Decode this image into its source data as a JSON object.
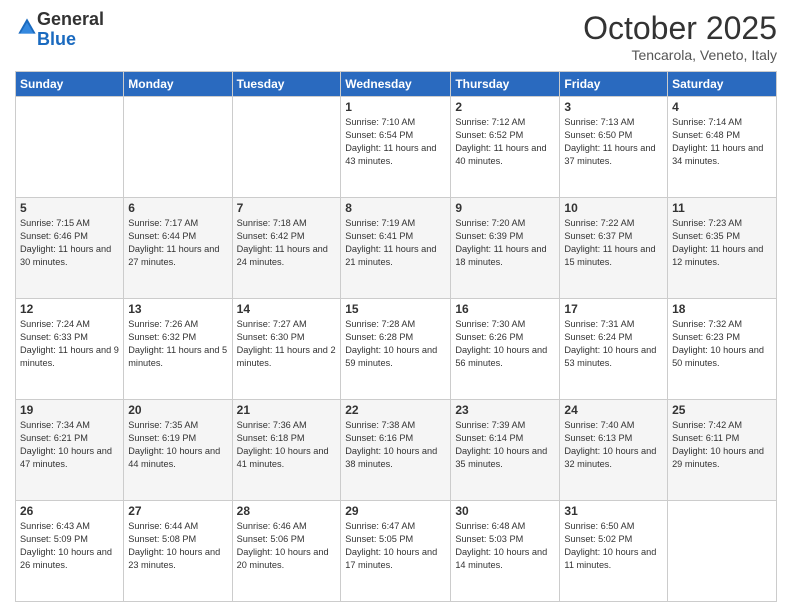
{
  "logo": {
    "general": "General",
    "blue": "Blue"
  },
  "header": {
    "month": "October 2025",
    "location": "Tencarola, Veneto, Italy"
  },
  "days_of_week": [
    "Sunday",
    "Monday",
    "Tuesday",
    "Wednesday",
    "Thursday",
    "Friday",
    "Saturday"
  ],
  "weeks": [
    [
      {
        "day": "",
        "sunrise": "",
        "sunset": "",
        "daylight": ""
      },
      {
        "day": "",
        "sunrise": "",
        "sunset": "",
        "daylight": ""
      },
      {
        "day": "",
        "sunrise": "",
        "sunset": "",
        "daylight": ""
      },
      {
        "day": "1",
        "sunrise": "Sunrise: 7:10 AM",
        "sunset": "Sunset: 6:54 PM",
        "daylight": "Daylight: 11 hours and 43 minutes."
      },
      {
        "day": "2",
        "sunrise": "Sunrise: 7:12 AM",
        "sunset": "Sunset: 6:52 PM",
        "daylight": "Daylight: 11 hours and 40 minutes."
      },
      {
        "day": "3",
        "sunrise": "Sunrise: 7:13 AM",
        "sunset": "Sunset: 6:50 PM",
        "daylight": "Daylight: 11 hours and 37 minutes."
      },
      {
        "day": "4",
        "sunrise": "Sunrise: 7:14 AM",
        "sunset": "Sunset: 6:48 PM",
        "daylight": "Daylight: 11 hours and 34 minutes."
      }
    ],
    [
      {
        "day": "5",
        "sunrise": "Sunrise: 7:15 AM",
        "sunset": "Sunset: 6:46 PM",
        "daylight": "Daylight: 11 hours and 30 minutes."
      },
      {
        "day": "6",
        "sunrise": "Sunrise: 7:17 AM",
        "sunset": "Sunset: 6:44 PM",
        "daylight": "Daylight: 11 hours and 27 minutes."
      },
      {
        "day": "7",
        "sunrise": "Sunrise: 7:18 AM",
        "sunset": "Sunset: 6:42 PM",
        "daylight": "Daylight: 11 hours and 24 minutes."
      },
      {
        "day": "8",
        "sunrise": "Sunrise: 7:19 AM",
        "sunset": "Sunset: 6:41 PM",
        "daylight": "Daylight: 11 hours and 21 minutes."
      },
      {
        "day": "9",
        "sunrise": "Sunrise: 7:20 AM",
        "sunset": "Sunset: 6:39 PM",
        "daylight": "Daylight: 11 hours and 18 minutes."
      },
      {
        "day": "10",
        "sunrise": "Sunrise: 7:22 AM",
        "sunset": "Sunset: 6:37 PM",
        "daylight": "Daylight: 11 hours and 15 minutes."
      },
      {
        "day": "11",
        "sunrise": "Sunrise: 7:23 AM",
        "sunset": "Sunset: 6:35 PM",
        "daylight": "Daylight: 11 hours and 12 minutes."
      }
    ],
    [
      {
        "day": "12",
        "sunrise": "Sunrise: 7:24 AM",
        "sunset": "Sunset: 6:33 PM",
        "daylight": "Daylight: 11 hours and 9 minutes."
      },
      {
        "day": "13",
        "sunrise": "Sunrise: 7:26 AM",
        "sunset": "Sunset: 6:32 PM",
        "daylight": "Daylight: 11 hours and 5 minutes."
      },
      {
        "day": "14",
        "sunrise": "Sunrise: 7:27 AM",
        "sunset": "Sunset: 6:30 PM",
        "daylight": "Daylight: 11 hours and 2 minutes."
      },
      {
        "day": "15",
        "sunrise": "Sunrise: 7:28 AM",
        "sunset": "Sunset: 6:28 PM",
        "daylight": "Daylight: 10 hours and 59 minutes."
      },
      {
        "day": "16",
        "sunrise": "Sunrise: 7:30 AM",
        "sunset": "Sunset: 6:26 PM",
        "daylight": "Daylight: 10 hours and 56 minutes."
      },
      {
        "day": "17",
        "sunrise": "Sunrise: 7:31 AM",
        "sunset": "Sunset: 6:24 PM",
        "daylight": "Daylight: 10 hours and 53 minutes."
      },
      {
        "day": "18",
        "sunrise": "Sunrise: 7:32 AM",
        "sunset": "Sunset: 6:23 PM",
        "daylight": "Daylight: 10 hours and 50 minutes."
      }
    ],
    [
      {
        "day": "19",
        "sunrise": "Sunrise: 7:34 AM",
        "sunset": "Sunset: 6:21 PM",
        "daylight": "Daylight: 10 hours and 47 minutes."
      },
      {
        "day": "20",
        "sunrise": "Sunrise: 7:35 AM",
        "sunset": "Sunset: 6:19 PM",
        "daylight": "Daylight: 10 hours and 44 minutes."
      },
      {
        "day": "21",
        "sunrise": "Sunrise: 7:36 AM",
        "sunset": "Sunset: 6:18 PM",
        "daylight": "Daylight: 10 hours and 41 minutes."
      },
      {
        "day": "22",
        "sunrise": "Sunrise: 7:38 AM",
        "sunset": "Sunset: 6:16 PM",
        "daylight": "Daylight: 10 hours and 38 minutes."
      },
      {
        "day": "23",
        "sunrise": "Sunrise: 7:39 AM",
        "sunset": "Sunset: 6:14 PM",
        "daylight": "Daylight: 10 hours and 35 minutes."
      },
      {
        "day": "24",
        "sunrise": "Sunrise: 7:40 AM",
        "sunset": "Sunset: 6:13 PM",
        "daylight": "Daylight: 10 hours and 32 minutes."
      },
      {
        "day": "25",
        "sunrise": "Sunrise: 7:42 AM",
        "sunset": "Sunset: 6:11 PM",
        "daylight": "Daylight: 10 hours and 29 minutes."
      }
    ],
    [
      {
        "day": "26",
        "sunrise": "Sunrise: 6:43 AM",
        "sunset": "Sunset: 5:09 PM",
        "daylight": "Daylight: 10 hours and 26 minutes."
      },
      {
        "day": "27",
        "sunrise": "Sunrise: 6:44 AM",
        "sunset": "Sunset: 5:08 PM",
        "daylight": "Daylight: 10 hours and 23 minutes."
      },
      {
        "day": "28",
        "sunrise": "Sunrise: 6:46 AM",
        "sunset": "Sunset: 5:06 PM",
        "daylight": "Daylight: 10 hours and 20 minutes."
      },
      {
        "day": "29",
        "sunrise": "Sunrise: 6:47 AM",
        "sunset": "Sunset: 5:05 PM",
        "daylight": "Daylight: 10 hours and 17 minutes."
      },
      {
        "day": "30",
        "sunrise": "Sunrise: 6:48 AM",
        "sunset": "Sunset: 5:03 PM",
        "daylight": "Daylight: 10 hours and 14 minutes."
      },
      {
        "day": "31",
        "sunrise": "Sunrise: 6:50 AM",
        "sunset": "Sunset: 5:02 PM",
        "daylight": "Daylight: 10 hours and 11 minutes."
      },
      {
        "day": "",
        "sunrise": "",
        "sunset": "",
        "daylight": ""
      }
    ]
  ]
}
